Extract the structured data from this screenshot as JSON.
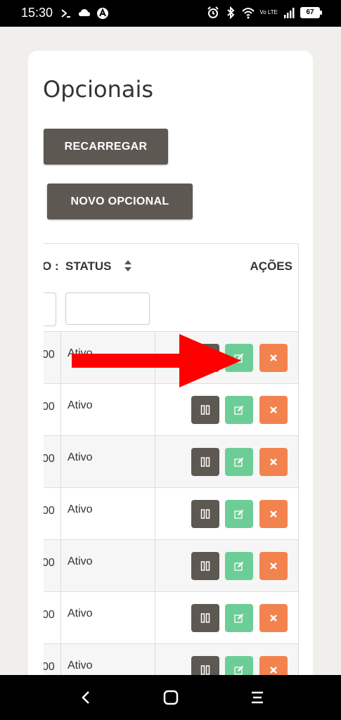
{
  "status_bar": {
    "time": "15:30",
    "battery": "67",
    "volte": "Vo LTE",
    "left_icons": [
      "vpn-icon",
      "cloud-icon",
      "app-notification-icon"
    ],
    "right_icons": [
      "alarm-icon",
      "bluetooth-icon",
      "wifi-icon",
      "volte-icon",
      "signal-icon",
      "battery-icon"
    ]
  },
  "page": {
    "title": "Opcionais",
    "reload_label": "RECARREGAR",
    "new_label": "NOVO OPCIONAL"
  },
  "table": {
    "columns": {
      "cut_header": "O :",
      "status_header": "STATUS",
      "actions_header": "AÇÕES"
    },
    "rows": [
      {
        "cut_value": "00",
        "status": "Ativo"
      },
      {
        "cut_value": "00",
        "status": "Ativo"
      },
      {
        "cut_value": "00",
        "status": "Ativo"
      },
      {
        "cut_value": "00",
        "status": "Ativo"
      },
      {
        "cut_value": "00",
        "status": "Ativo"
      },
      {
        "cut_value": "00",
        "status": "Ativo"
      },
      {
        "cut_value": "00",
        "status": "Ativo"
      }
    ],
    "action_icons": [
      "pause-icon",
      "edit-icon",
      "delete-icon"
    ]
  },
  "colors": {
    "dark_button": "#5e5853",
    "edit_button": "#6cce96",
    "delete_button": "#f2834f",
    "annotation_arrow": "#ff0000"
  },
  "nav_bar": {
    "icons": [
      "back-icon",
      "home-icon",
      "menu-icon"
    ]
  }
}
